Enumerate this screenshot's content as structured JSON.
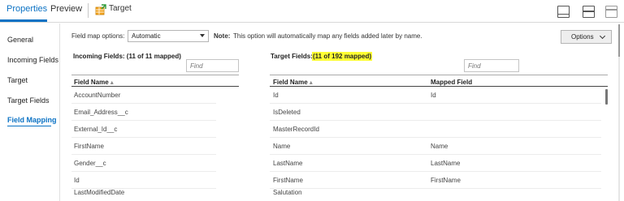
{
  "tabs": {
    "properties": "Properties",
    "preview": "Preview",
    "target": "Target"
  },
  "icons": {
    "target": "target-table-icon",
    "layouts": [
      "layout-bottom-panel-icon",
      "layout-split-horizontal-icon",
      "layout-top-panel-icon"
    ]
  },
  "sidebar": {
    "items": [
      {
        "label": "General",
        "active": false
      },
      {
        "label": "Incoming Fields",
        "active": false
      },
      {
        "label": "Target",
        "active": false
      },
      {
        "label": "Target Fields",
        "active": false
      },
      {
        "label": "Field Mapping",
        "active": true
      }
    ]
  },
  "field_map": {
    "label": "Field map options:",
    "selected": "Automatic",
    "note_bold": "Note:",
    "note_text": "This option will automatically map any fields added later by name."
  },
  "options_button": "Options",
  "incoming": {
    "title": "Incoming Fields: (11 of 11 mapped)",
    "find_placeholder": "Find",
    "col_header": "Field Name",
    "rows": [
      "AccountNumber",
      "Email_Address__c",
      "External_Id__c",
      "FirstName",
      "Gender__c",
      "Id",
      "LastModifiedDate"
    ]
  },
  "target": {
    "title_label": "Target Fields:",
    "title_count": "(11 of 192 mapped)",
    "find_placeholder": "Find",
    "col_name": "Field Name",
    "col_mapped": "Mapped Field",
    "rows": [
      {
        "name": "Id",
        "mapped": "Id"
      },
      {
        "name": "IsDeleted",
        "mapped": ""
      },
      {
        "name": "MasterRecordId",
        "mapped": ""
      },
      {
        "name": "Name",
        "mapped": "Name"
      },
      {
        "name": "LastName",
        "mapped": "LastName"
      },
      {
        "name": "FirstName",
        "mapped": "FirstName"
      },
      {
        "name": "Salutation",
        "mapped": ""
      }
    ]
  },
  "colors": {
    "accent": "#0b72c4",
    "highlight": "#ffff33"
  }
}
